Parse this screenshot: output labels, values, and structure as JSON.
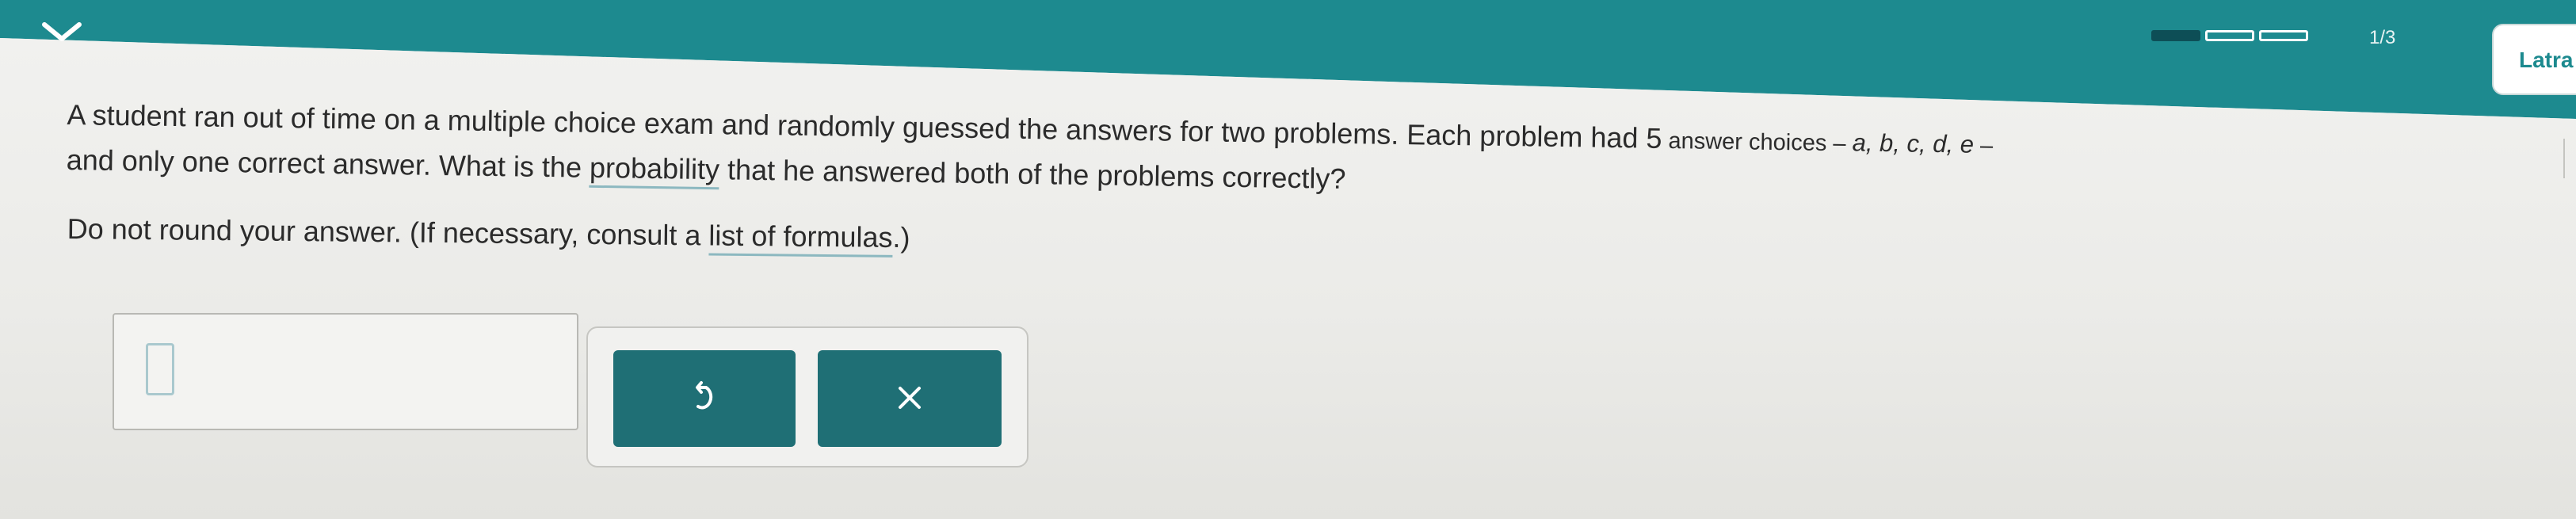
{
  "header": {
    "progress": {
      "label": "1/3",
      "segments_total": 3,
      "segments_completed": 1
    },
    "language_button_label": "Latra"
  },
  "question": {
    "line1": "A student ran out of time on a multiple choice exam and randomly guessed the answers for two problems. Each problem had 5",
    "line1_small": " answer choices – ",
    "choices": "a, b, c, d, e",
    "line1_end": " –",
    "line2_start": "and only one correct answer. What is the ",
    "probability_link": "probability",
    "line2_end": " that he answered both of the problems correctly?"
  },
  "instruction": {
    "text": "Do not round your answer. (If necessary, consult a ",
    "formulas_link": "list of formulas",
    "text_end": ".)"
  },
  "answer": {
    "value": ""
  },
  "icons": {
    "collapse": "chevron-down-icon",
    "undo": "undo-icon",
    "clear": "close-icon"
  },
  "colors": {
    "header": "#1d8a8f",
    "button": "#1f6f75",
    "progress_filled": "#0d4e56"
  }
}
